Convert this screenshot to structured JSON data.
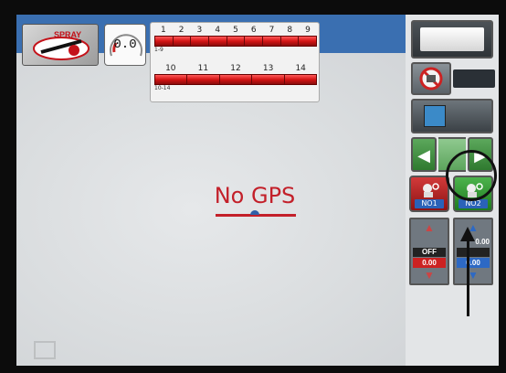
{
  "speedometer": {
    "value": "0.0"
  },
  "logo": {
    "brand": "SPRAY"
  },
  "boom": {
    "row1_numbers": [
      "1",
      "2",
      "3",
      "4",
      "5",
      "6",
      "7",
      "8",
      "9"
    ],
    "row1_tag": "1-9",
    "row2_numbers": [
      "10",
      "11",
      "12",
      "13",
      "14"
    ],
    "row2_tag": "10-14"
  },
  "status": {
    "message": "No GPS"
  },
  "sidebar": {
    "coverage_label": "",
    "nozzle1_label": "NO1",
    "nozzle2_label": "NO2",
    "rate1": {
      "value": "",
      "state": "OFF",
      "number": "0.00"
    },
    "rate2": {
      "value": "0.00",
      "state": "",
      "number": "0.00"
    }
  },
  "colors": {
    "title_bar": "#3a6fb1",
    "no_gps_text": "#c3202a",
    "boom_section": "#d41414",
    "nozzle_off": "#8c1313",
    "nozzle_on": "#1f7a1f"
  }
}
